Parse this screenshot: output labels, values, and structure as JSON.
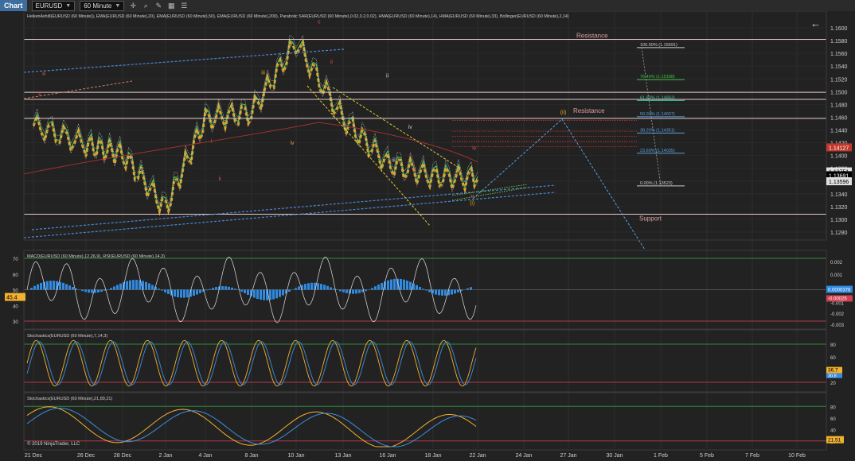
{
  "toolbar": {
    "tab_label": "Chart",
    "instrument": "EURUSD",
    "interval": "60 Minute"
  },
  "price_panel": {
    "indicators_label": "HeikenAshi8(EURUSD (60 Minute)), EMA(EURUSD (60 Minute),20), EMA(EURUSD (60 Minute),50), EMA(EURUSD (60 Minute),200), Parabolic SAR(EURUSD (60 Minute),0.02,0.2,0.02), HMA(EURUSD (60 Minute),14), HMA(EURUSD (60 Minute),33), Bollinger(EURUSD (60 Minute),2,14)",
    "price_ticks": [
      "1.1600",
      "1.1580",
      "1.1560",
      "1.1540",
      "1.1520",
      "1.1500",
      "1.1480",
      "1.1460",
      "1.1440",
      "1.1420",
      "1.1400",
      "1.1380",
      "1.1360",
      "1.1340",
      "1.1320",
      "1.1300",
      "1.1280"
    ],
    "price_markers": [
      {
        "label": "1.14127",
        "price": 1.14127,
        "color": "#c0392b"
      },
      {
        "label": "1.13751",
        "price": 1.13751,
        "color": "#e0e0e0"
      },
      {
        "label": "1.13691",
        "price": 1.13691,
        "color": "#000000"
      },
      {
        "label": "1.13596",
        "price": 1.13596,
        "color": "#e0e0e0"
      }
    ],
    "fib_levels": [
      {
        "label": "100.00% (1.15691)",
        "price": 1.15691,
        "color": "#cccccc"
      },
      {
        "label": "76.40% (1.15188)",
        "price": 1.15188,
        "color": "#3fbf3f"
      },
      {
        "label": "61.80% (1.14863)",
        "price": 1.14863,
        "color": "#3fbf9f"
      },
      {
        "label": "50.00% (1.14607)",
        "price": 1.14607,
        "color": "#5aa0e0"
      },
      {
        "label": "38.20% (1.14351)",
        "price": 1.14351,
        "color": "#5aa0e0"
      },
      {
        "label": "23.60% (1.14035)",
        "price": 1.14035,
        "color": "#5aa0e0"
      },
      {
        "label": "0.00% (1.13523)",
        "price": 1.13523,
        "color": "#cccccc"
      }
    ],
    "resistance_label_top": "Resistance",
    "resistance_label_mid": "Resistance",
    "support_label": "Support",
    "wave_labels": [
      {
        "text": "a",
        "x": 0.5,
        "price": 1.1526,
        "color": "#e05050"
      },
      {
        "text": "v",
        "x": 0.3,
        "price": 1.1494,
        "color": "#e05050"
      },
      {
        "text": "i",
        "x": 8.6,
        "price": 1.142,
        "color": "#e05050"
      },
      {
        "text": "ii",
        "x": 9.0,
        "price": 1.1361,
        "color": "#e05050"
      },
      {
        "text": "iii",
        "x": 11.1,
        "price": 1.1527,
        "color": "#e0a020"
      },
      {
        "text": "iv",
        "x": 12.5,
        "price": 1.1417,
        "color": "#e0a020"
      },
      {
        "text": "c",
        "x": 13.8,
        "price": 1.1607,
        "color": "#e05050"
      },
      {
        "text": "ii",
        "x": 14.4,
        "price": 1.1544,
        "color": "#e05050"
      },
      {
        "text": "i",
        "x": 15.0,
        "price": 1.1442,
        "color": "#cccccc"
      },
      {
        "text": "ii",
        "x": 17.1,
        "price": 1.1522,
        "color": "#cccccc"
      },
      {
        "text": "iii",
        "x": 17.4,
        "price": 1.139,
        "color": "#cccccc"
      },
      {
        "text": "iv",
        "x": 18.2,
        "price": 1.1442,
        "color": "#cccccc"
      },
      {
        "text": "iii",
        "x": 18.4,
        "price": 1.1376,
        "color": "#e05050"
      },
      {
        "text": "iv",
        "x": 21.3,
        "price": 1.1409,
        "color": "#e05050"
      },
      {
        "text": "v",
        "x": 21.2,
        "price": 1.1334,
        "color": "#e05050"
      },
      {
        "text": "(i)",
        "x": 21.2,
        "price": 1.1323,
        "color": "#e0a020"
      },
      {
        "text": "(ii)",
        "x": 25.6,
        "price": 1.1465,
        "color": "#e0a020"
      }
    ]
  },
  "macd_panel": {
    "label": "MACD(EURUSD (60 Minute),12,26,9), RSI(EURUSD (60 Minute),14,3)",
    "left_ticks": [
      "70",
      "60",
      "50",
      "40",
      "30"
    ],
    "right_ticks": [
      "0.002",
      "0.001",
      "-0.001",
      "-0.002",
      "-0.003"
    ],
    "rsi_marker": "45.4",
    "macd_markers": [
      "0.0000378",
      "-0.00025"
    ]
  },
  "stoch_fast_panel": {
    "label": "Stochastics(EURUSD (60 Minute),7,14,3)",
    "ticks": [
      "80",
      "60",
      "40",
      "20"
    ],
    "markers": [
      "36.7",
      "30.8"
    ]
  },
  "stoch_slow_panel": {
    "label": "Stochastics(EURUSD (60 Minute),21,89,21)",
    "ticks": [
      "80",
      "60",
      "40",
      "20"
    ],
    "marker": "21.51",
    "copyright": "© 2019 NinjaTrader, LLC"
  },
  "time_axis": [
    "21 Dec",
    "26 Dec",
    "28 Dec",
    "2 Jan",
    "4 Jan",
    "8 Jan",
    "10 Jan",
    "13 Jan",
    "16 Jan",
    "18 Jan",
    "22 Jan",
    "24 Jan",
    "27 Jan",
    "30 Jan",
    "1 Feb",
    "5 Feb",
    "7 Feb",
    "10 Feb"
  ],
  "chart_data": {
    "type": "line",
    "title": "",
    "x_unit_note": "",
    "x": [
      "21 Dec",
      "26 Dec",
      "28 Dec",
      "2 Jan",
      "4 Jan",
      "8 Jan",
      "10 Jan",
      "13 Jan",
      "16 Jan",
      "18 Jan",
      "22 Jan"
    ],
    "ylim": [
      1.127,
      1.161
    ],
    "horizontal_levels": [
      {
        "name": "Resistance",
        "value": 1.1582
      },
      {
        "name": "",
        "value": 1.1499
      },
      {
        "name": "",
        "value": 1.1488
      },
      {
        "name": "",
        "value": 1.1458
      },
      {
        "name": "Support",
        "value": 1.1308
      }
    ],
    "series": [
      {
        "name": "",
        "values": [
          1.145,
          1.142,
          1.1405,
          1.132,
          1.146,
          1.147,
          1.158,
          1.146,
          1.139,
          1.137,
          1.1367
        ]
      }
    ]
  }
}
